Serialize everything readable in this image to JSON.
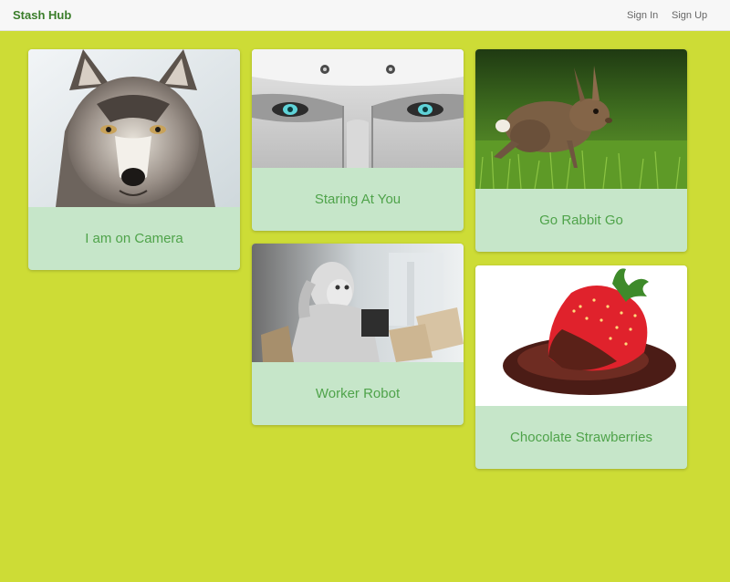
{
  "navbar": {
    "brand": "Stash Hub",
    "sign_in": "Sign In",
    "sign_up": "Sign Up"
  },
  "cards": [
    {
      "caption": "I am on Camera",
      "image": "wolf-photo"
    },
    {
      "caption": "Staring At You",
      "image": "robot-face-photo"
    },
    {
      "caption": "Go Rabbit Go",
      "image": "rabbit-photo"
    },
    {
      "caption": "Worker Robot",
      "image": "thinking-robot-photo"
    },
    {
      "caption": "Chocolate Strawberries",
      "image": "chocolate-strawberry-photo"
    }
  ],
  "colors": {
    "page_background": "#cddc36",
    "card_background": "#c6e6c9",
    "caption_text": "#4fa34a",
    "brand_text": "#3a7d2a"
  }
}
